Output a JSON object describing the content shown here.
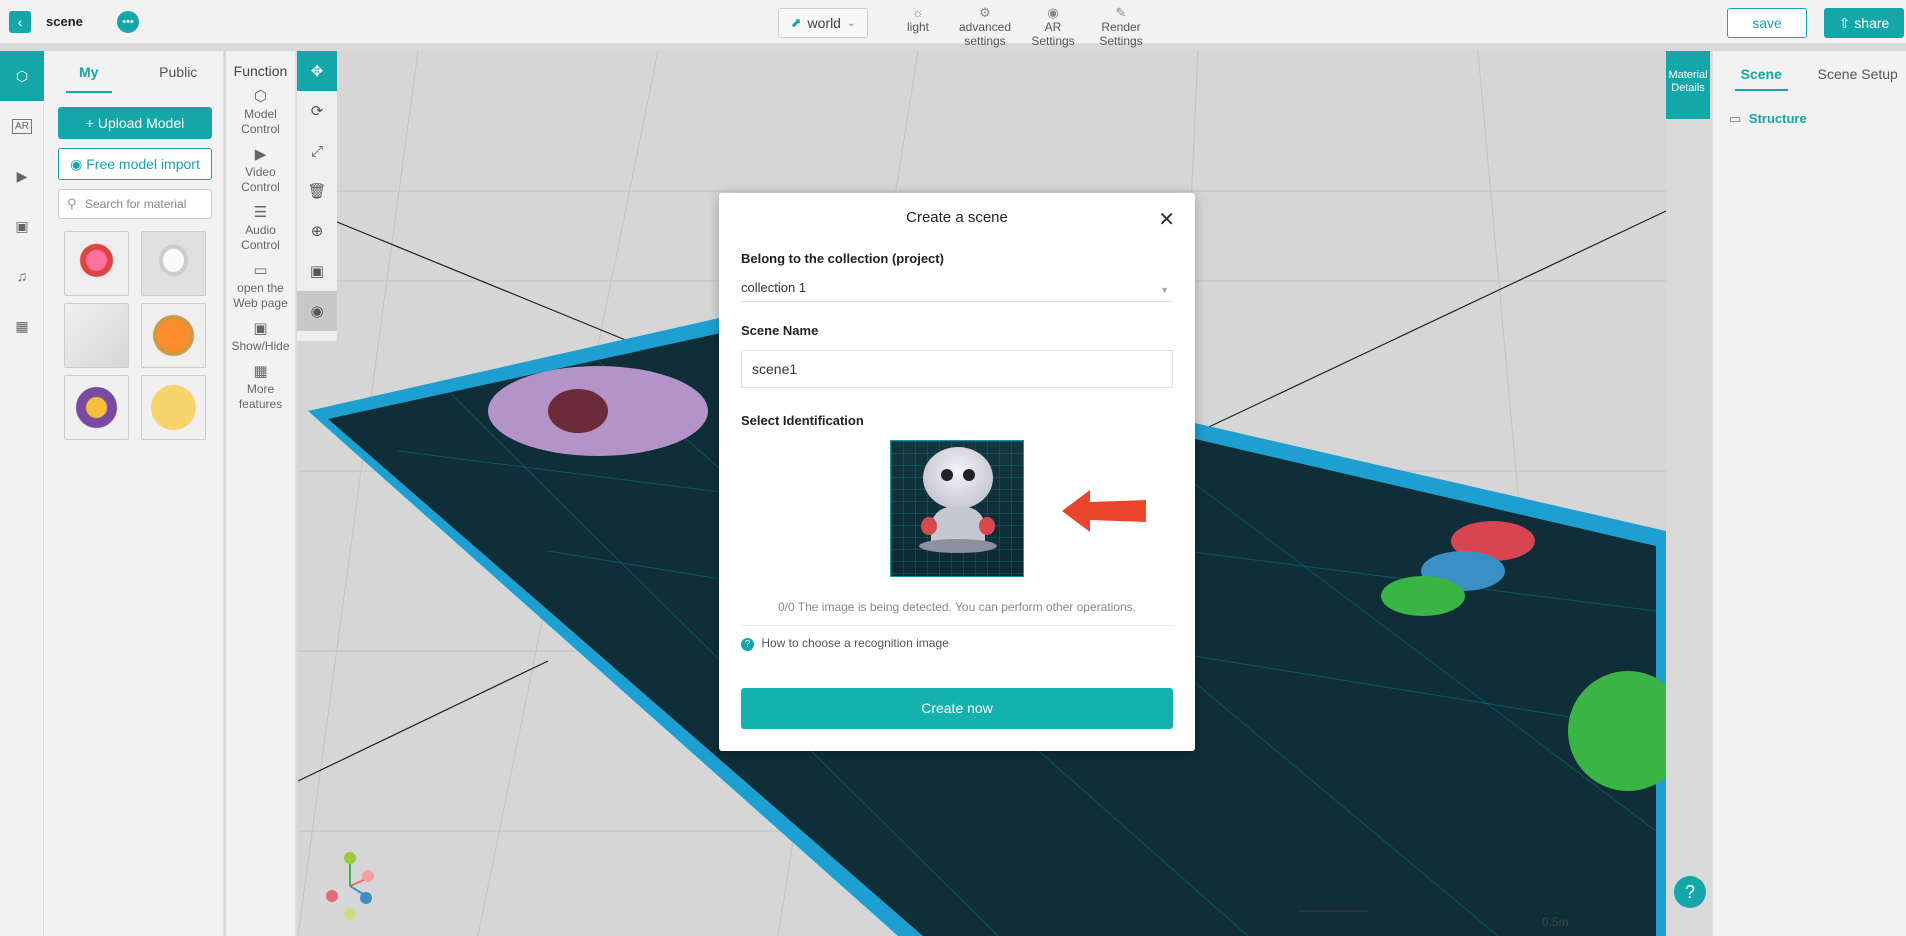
{
  "header": {
    "back_icon": "chevron-left-icon",
    "title": "scene",
    "chat_icon": "chat-bubble-icon",
    "world_select": "world",
    "tools": [
      {
        "label": "light",
        "icon": "sun-icon"
      },
      {
        "label": "advanced settings",
        "icon": "gear-icon"
      },
      {
        "label": "AR Settings",
        "icon": "ar-icon"
      },
      {
        "label": "Render Settings",
        "icon": "render-icon"
      }
    ],
    "save_label": "save",
    "share_label": "share"
  },
  "rail": {
    "items": [
      {
        "icon": "cube-icon",
        "active": true
      },
      {
        "icon": "ar-icon",
        "active": false
      },
      {
        "icon": "video-icon",
        "active": false
      },
      {
        "icon": "image-icon",
        "active": false
      },
      {
        "icon": "music-icon",
        "active": false
      },
      {
        "icon": "frame-icon",
        "active": false
      }
    ]
  },
  "material": {
    "tabs": [
      "My",
      "Public"
    ],
    "active_tab": "My",
    "upload_label": "Upload Model",
    "import_label": "Free model import",
    "search_placeholder": "Search for material",
    "thumbnails": [
      "flower-figure",
      "white-figure",
      "grey-object",
      "goldfish",
      "butterfly",
      "smiley-ball"
    ]
  },
  "function": {
    "title": "Function",
    "items": [
      {
        "label": "Model Control",
        "icon": "cube-icon"
      },
      {
        "label": "Video Control",
        "icon": "play-icon"
      },
      {
        "label": "Audio Control",
        "icon": "sliders-icon"
      },
      {
        "label": "open the Web page",
        "icon": "airplay-icon"
      },
      {
        "label": "Show/Hide",
        "icon": "window-icon"
      },
      {
        "label": "More features",
        "icon": "grid-icon"
      }
    ]
  },
  "toolcol": [
    "move-icon",
    "rotate-icon",
    "scale-icon",
    "delete-icon",
    "target-icon",
    "fit-icon",
    "eye-icon"
  ],
  "viewport": {
    "material_details": "Material Details",
    "scale_label": "0.5m",
    "help_icon": "help-icon"
  },
  "right_panel": {
    "tabs": [
      "Scene",
      "Scene Setup"
    ],
    "active_tab": "Scene",
    "structure_label": "Structure"
  },
  "modal": {
    "title": "Create a scene",
    "collection_label": "Belong to the collection (project)",
    "collection_value": "collection 1",
    "scene_name_label": "Scene Name",
    "scene_name_value": "scene1",
    "identification_label": "Select Identification",
    "detect_text": "0/0 The image is being detected. You can perform other operations.",
    "howto_text": "How to choose a recognition image",
    "create_label": "Create now"
  },
  "colors": {
    "accent": "#14a6a8",
    "arrow": "#e8452b"
  }
}
